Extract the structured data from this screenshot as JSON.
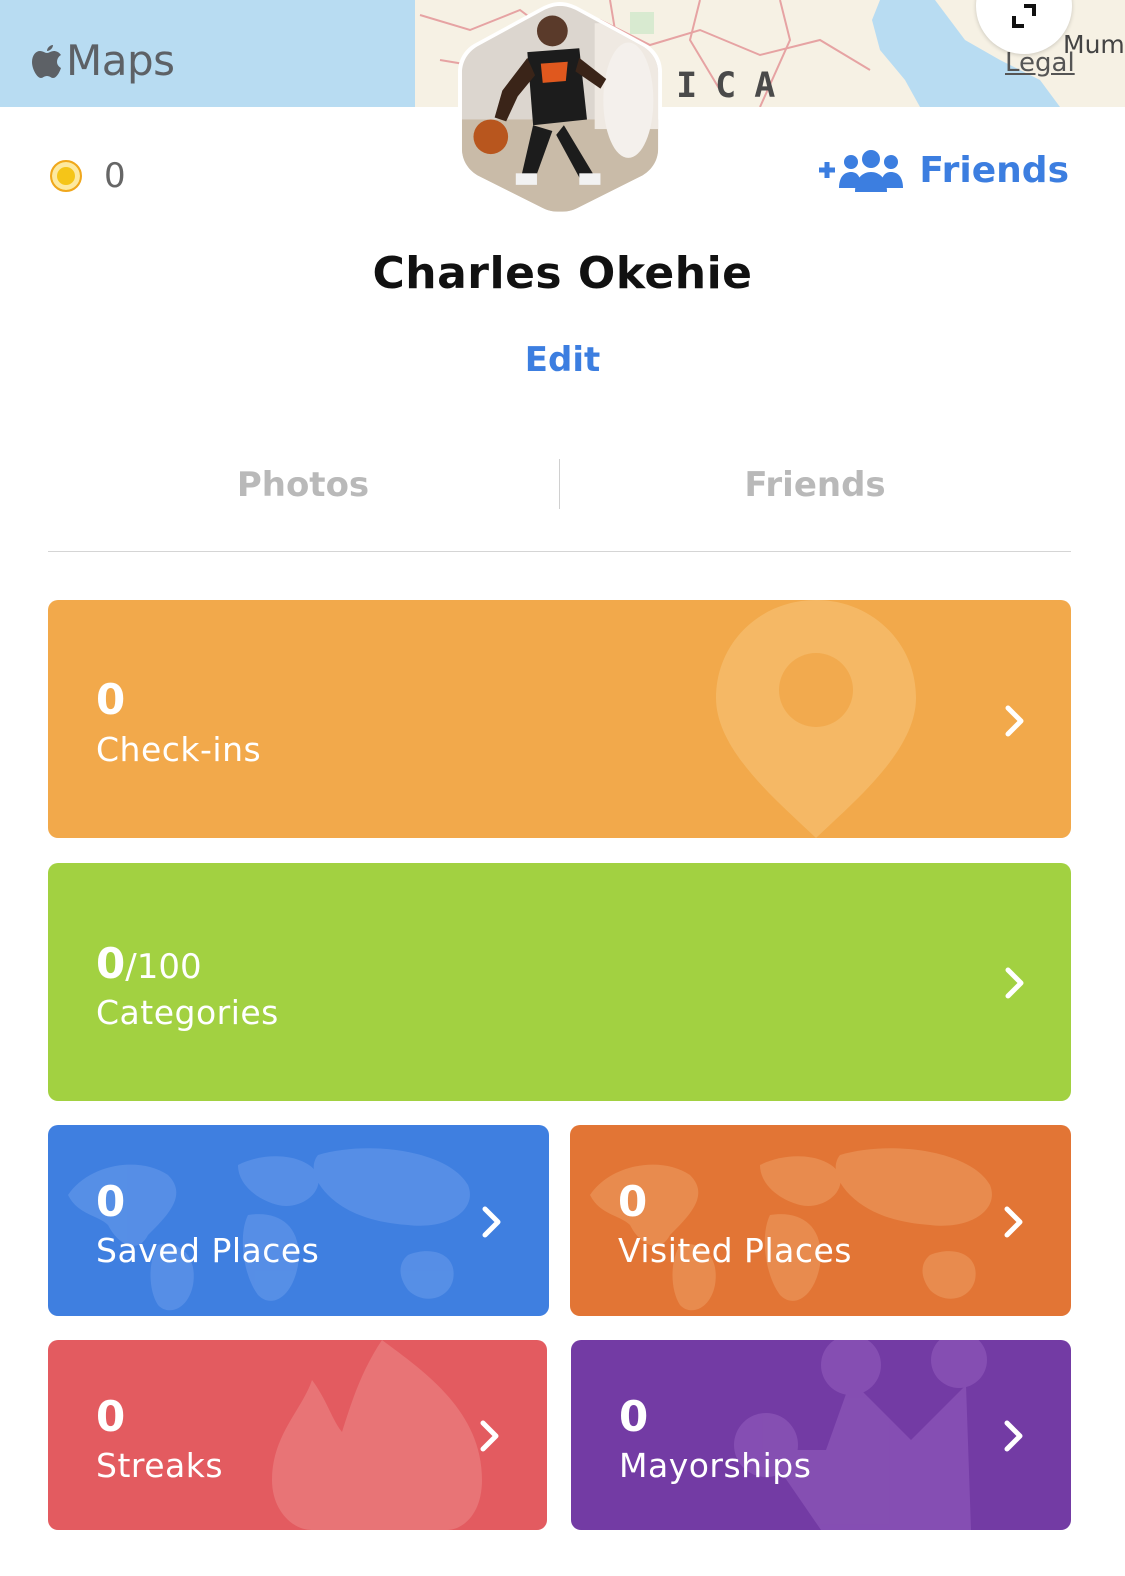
{
  "map": {
    "brand": "Maps",
    "region_label": "RICA",
    "legal_link": "Legal",
    "city_label": "Mum"
  },
  "profile": {
    "coins": "0",
    "name": "Charles Okehie",
    "edit_label": "Edit",
    "friends_button_label": "Friends"
  },
  "tabs": [
    {
      "label": "Photos"
    },
    {
      "label": "Friends"
    }
  ],
  "cards": {
    "checkins": {
      "value": "0",
      "label": "Check-ins"
    },
    "categories": {
      "value": "0",
      "total": "/100",
      "label": "Categories"
    },
    "saved_places": {
      "value": "0",
      "label": "Saved Places"
    },
    "visited_places": {
      "value": "0",
      "label": "Visited Places"
    },
    "streaks": {
      "value": "0",
      "label": "Streaks"
    },
    "mayorships": {
      "value": "0",
      "label": "Mayorships"
    }
  },
  "colors": {
    "accent": "#3c7ee0",
    "checkins": "#f2a94b",
    "categories": "#a2d141",
    "saved_places": "#3f7fe0",
    "visited_places": "#e27535",
    "streaks": "#e35b60",
    "mayorships": "#733ba4"
  },
  "icons": {
    "brand": "apple-icon",
    "expand": "expand-icon",
    "coin": "coin-icon",
    "add_friends": "add-friends-icon",
    "chevron": "chevron-right-icon"
  }
}
